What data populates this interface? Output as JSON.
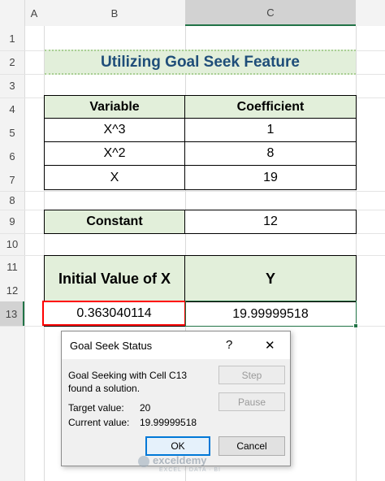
{
  "sheet": {
    "columns": [
      "A",
      "B",
      "C"
    ],
    "rows": [
      "1",
      "2",
      "3",
      "4",
      "5",
      "6",
      "7",
      "8",
      "9",
      "10",
      "11",
      "12",
      "13"
    ],
    "title": "Utilizing Goal Seek Feature",
    "table": {
      "headers": [
        "Variable",
        "Coefficient"
      ],
      "rows": [
        {
          "variable": "X^3",
          "coefficient": "1"
        },
        {
          "variable": "X^2",
          "coefficient": "8"
        },
        {
          "variable": "X",
          "coefficient": "19"
        }
      ]
    },
    "constant": {
      "label": "Constant",
      "value": "12"
    },
    "result": {
      "headers": [
        "Initial Value of X",
        "Y"
      ],
      "x_value": "0.363040114",
      "y_value": "19.99999518"
    }
  },
  "dialog": {
    "title": "Goal Seek Status",
    "help": "?",
    "close": "✕",
    "message_line1": "Goal Seeking with Cell C13",
    "message_line2": "found a solution.",
    "target_label": "Target value:",
    "target_value": "20",
    "current_label": "Current value:",
    "current_value": "19.99999518",
    "step_label": "Step",
    "pause_label": "Pause",
    "ok_label": "OK",
    "cancel_label": "Cancel"
  },
  "watermark": {
    "brand": "exceldemy",
    "tagline": "EXCEL · DATA · BI"
  },
  "colors": {
    "header_fill": "#e2efda",
    "select_red": "#ff0000",
    "active_green": "#217346"
  }
}
